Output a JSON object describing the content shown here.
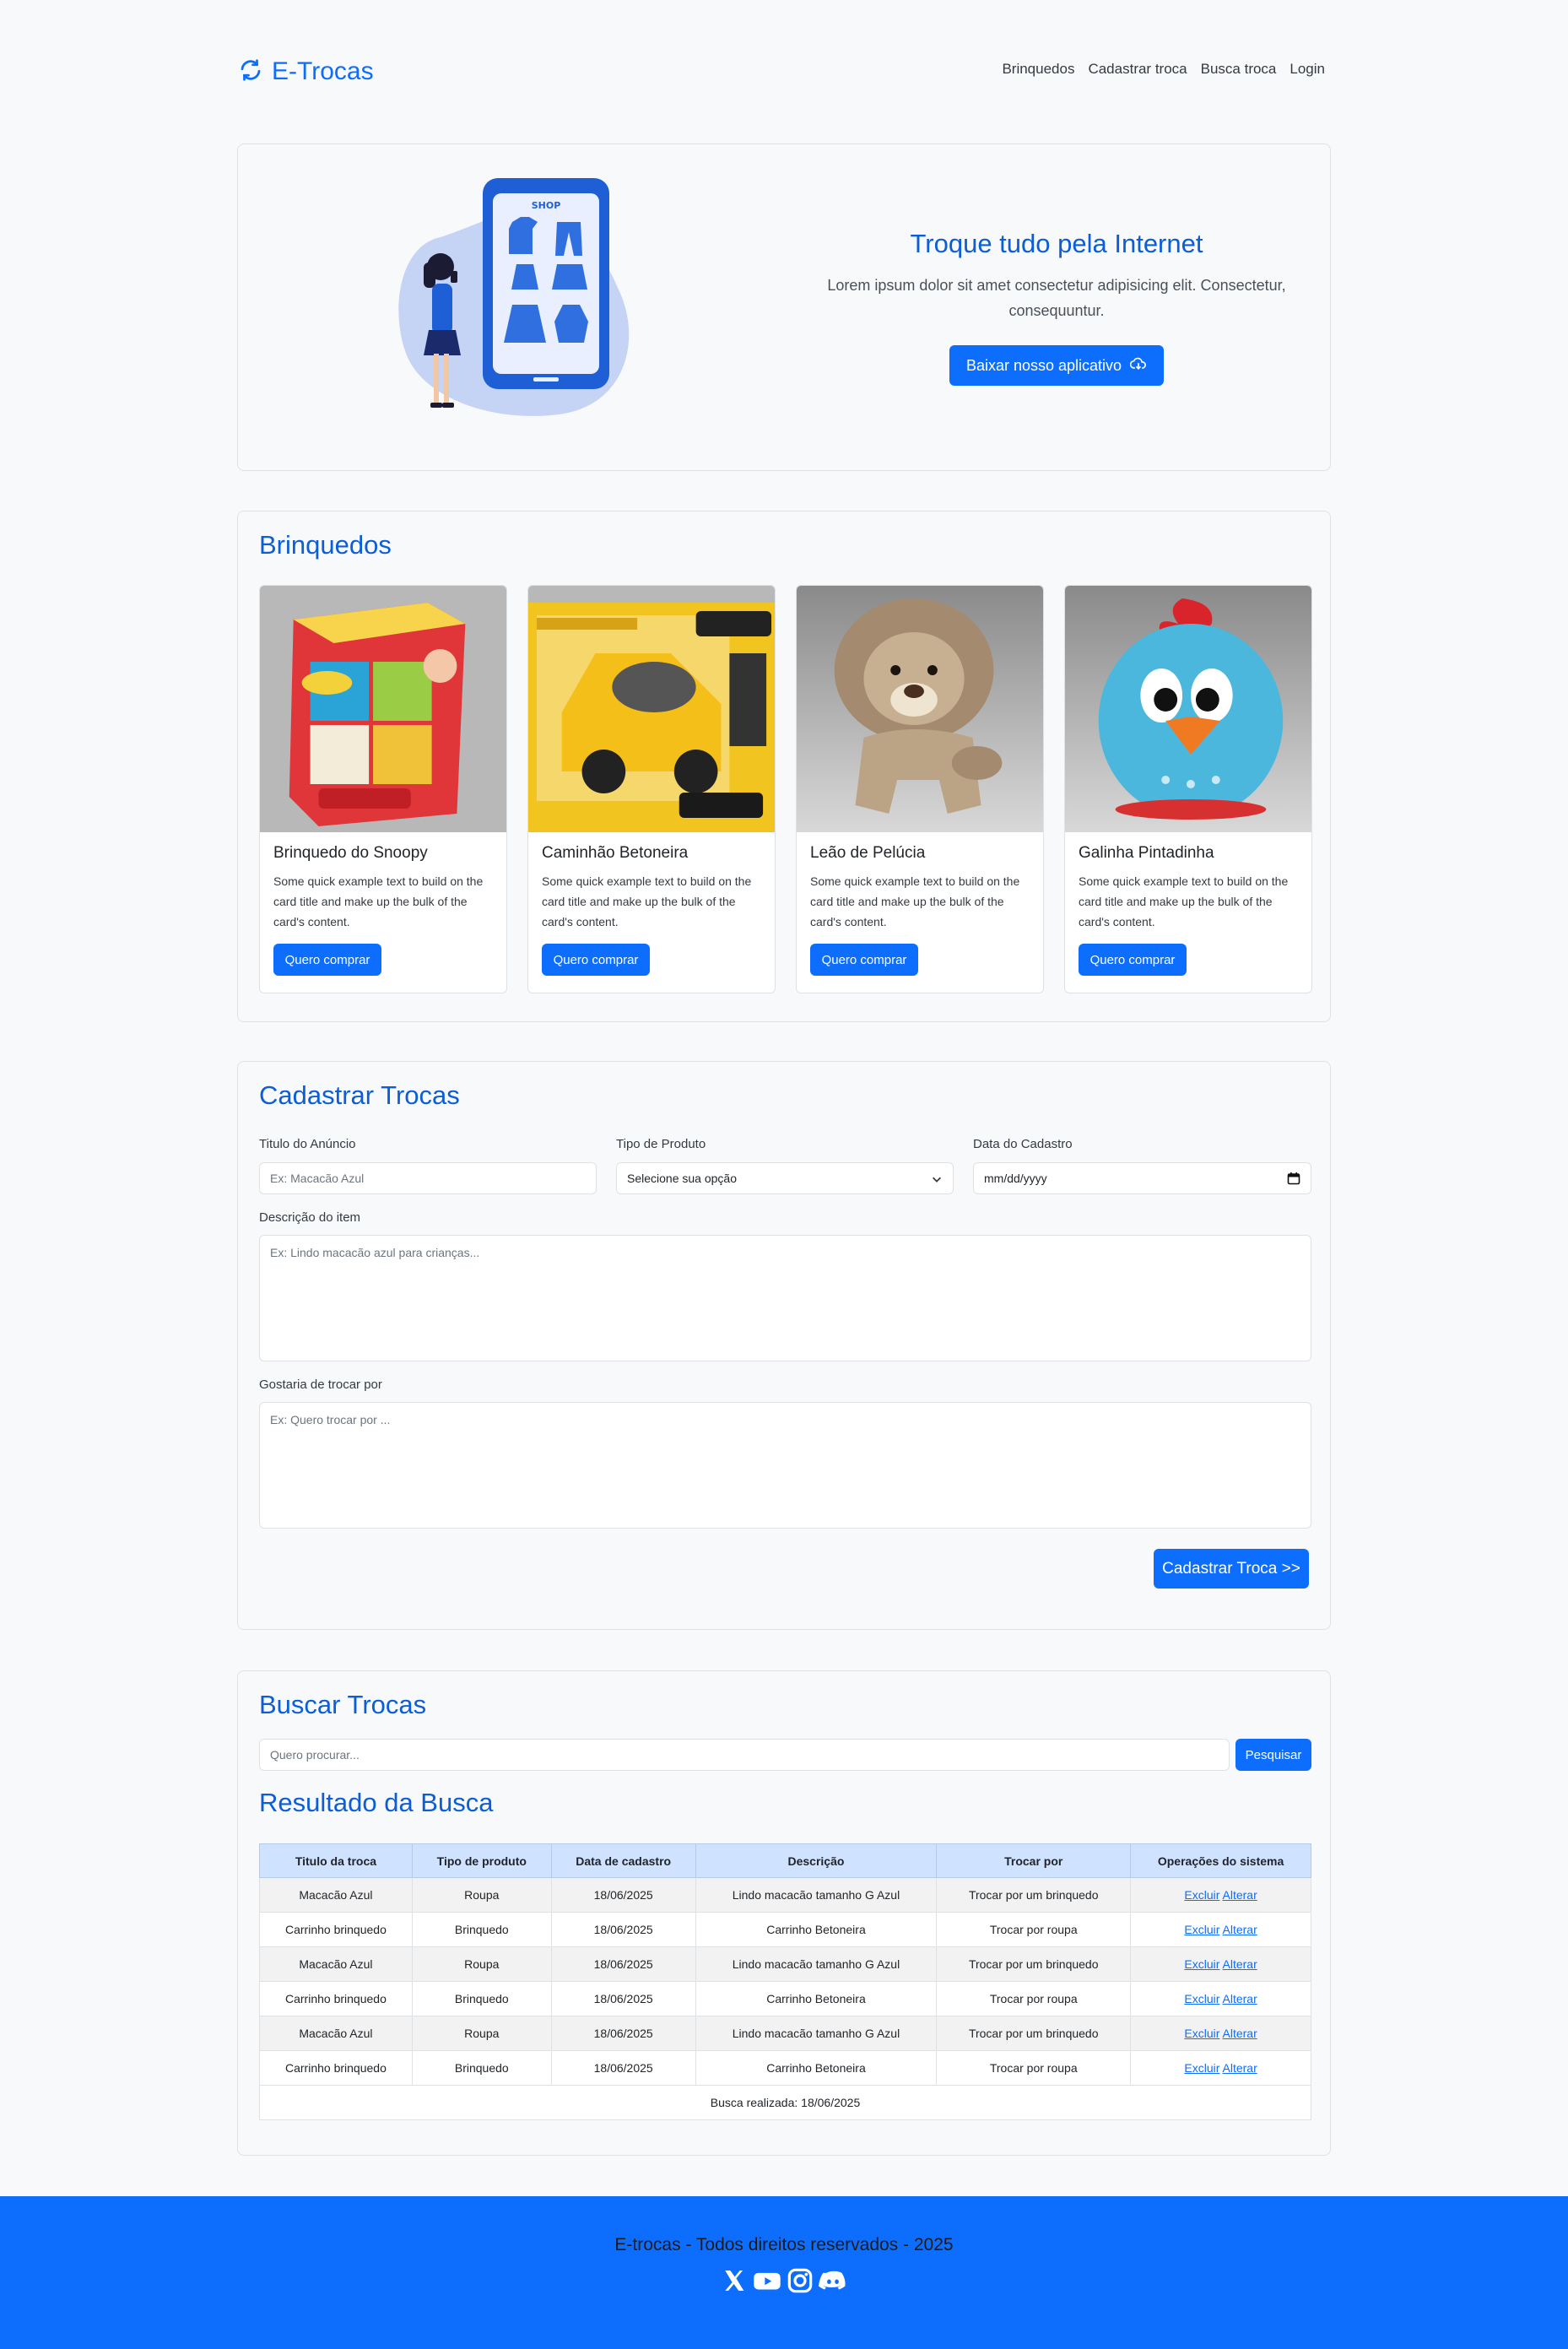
{
  "header": {
    "brand": "E-Trocas",
    "nav": [
      "Brinquedos",
      "Cadastrar troca",
      "Busca troca",
      "Login"
    ]
  },
  "hero": {
    "illustration_text": "SHOP",
    "title": "Troque tudo pela Internet",
    "subtitle": "Lorem ipsum dolor sit amet consectetur adipisicing elit. Consectetur, consequuntur.",
    "button": "Baixar nosso aplicativo"
  },
  "toys": {
    "title": "Brinquedos",
    "items": [
      {
        "name": "Brinquedo do Snoopy",
        "text": "Some quick example text to build on the card title and make up the bulk of the card's content.",
        "button": "Quero comprar"
      },
      {
        "name": "Caminhão Betoneira",
        "text": "Some quick example text to build on the card title and make up the bulk of the card's content.",
        "button": "Quero comprar"
      },
      {
        "name": "Leão de Pelúcia",
        "text": "Some quick example text to build on the card title and make up the bulk of the card's content.",
        "button": "Quero comprar"
      },
      {
        "name": "Galinha Pintadinha",
        "text": "Some quick example text to build on the card title and make up the bulk of the card's content.",
        "button": "Quero comprar"
      }
    ]
  },
  "form": {
    "title": "Cadastrar Trocas",
    "title_label": "Titulo do Anúncio",
    "title_placeholder": "Ex: Macacão Azul",
    "type_label": "Tipo de Produto",
    "type_value": "Selecione sua opção",
    "date_label": "Data do Cadastro",
    "date_value": "mm/dd/yyyy",
    "desc_label": "Descrição do item",
    "desc_placeholder": "Ex: Lindo macacão azul para crianças...",
    "trade_label": "Gostaria de trocar por",
    "trade_placeholder": "Ex: Quero trocar por ...",
    "submit": "Cadastrar Troca >>"
  },
  "search": {
    "title": "Buscar Trocas",
    "placeholder": "Quero procurar...",
    "button": "Pesquisar",
    "results_title": "Resultado da Busca",
    "columns": [
      "Titulo da troca",
      "Tipo de produto",
      "Data de cadastro",
      "Descrição",
      "Trocar por",
      "Operações do sistema"
    ],
    "rows": [
      [
        "Macacão Azul",
        "Roupa",
        "18/06/2025",
        "Lindo macacão tamanho G Azul",
        "Trocar por um brinquedo"
      ],
      [
        "Carrinho brinquedo",
        "Brinquedo",
        "18/06/2025",
        "Carrinho Betoneira",
        "Trocar por roupa"
      ],
      [
        "Macacão Azul",
        "Roupa",
        "18/06/2025",
        "Lindo macacão tamanho G Azul",
        "Trocar por um brinquedo"
      ],
      [
        "Carrinho brinquedo",
        "Brinquedo",
        "18/06/2025",
        "Carrinho Betoneira",
        "Trocar por roupa"
      ],
      [
        "Macacão Azul",
        "Roupa",
        "18/06/2025",
        "Lindo macacão tamanho G Azul",
        "Trocar por um brinquedo"
      ],
      [
        "Carrinho brinquedo",
        "Brinquedo",
        "18/06/2025",
        "Carrinho Betoneira",
        "Trocar por roupa"
      ]
    ],
    "op_delete": "Excluir",
    "op_edit": "Alterar",
    "footer": "Busca realizada: 18/06/2025"
  },
  "footer": {
    "text": "E-trocas - Todos direitos reservados - 2025",
    "icons": [
      "x-icon",
      "youtube-icon",
      "instagram-icon",
      "discord-icon"
    ]
  },
  "colors": {
    "primary": "#0d6efd",
    "heading": "#0b5ed7",
    "table_header": "#cfe2ff"
  }
}
